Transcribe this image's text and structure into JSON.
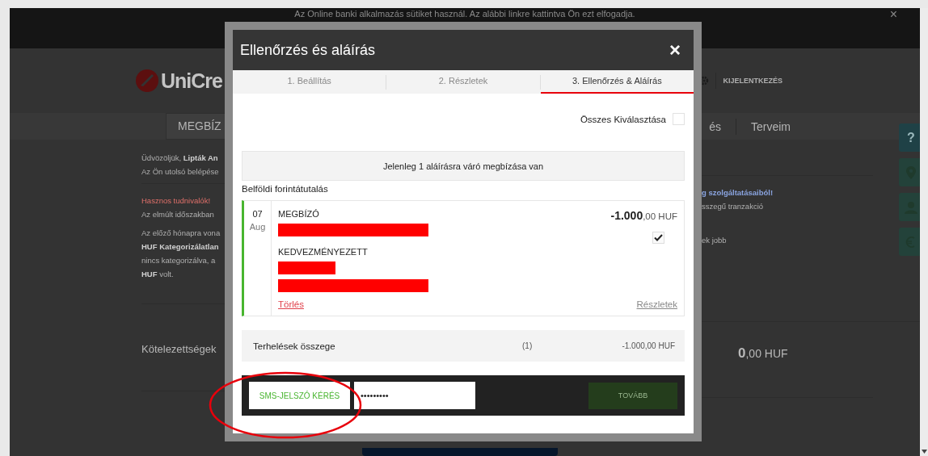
{
  "cookie_bar": {
    "text": "Az Online banki alkalmazás sütiket használ. Az alábbi linkre kattintva Ön ezt elfogadja.",
    "close": "×"
  },
  "header": {
    "logo": "UniCre",
    "logout": "KIJELENTKEZÉS"
  },
  "nav": [
    {
      "label": "MEGBÍZ",
      "selected": true
    },
    {
      "label": "és",
      "selected": false
    },
    {
      "label": "Terveim",
      "selected": false
    }
  ],
  "left_column": {
    "greeting": "Üdvözöljük, **Lipták An**",
    "last_login": "Az Ön utolsó belépése",
    "notice_title": "Hasznos tudnivalók!",
    "notice_text": "Az elmúlt időszakban",
    "summary": [
      "Az előző hónapra vona",
      "**HUF Kategorizálatlan**",
      "nincs kategorizálva, a",
      "**HUF** volt."
    ],
    "liabilities": "Kötelezettségek"
  },
  "help_button": "?",
  "right_column": {
    "notice_link": "g szolgáltatásaiból!",
    "notice_text": "sszegű tranzakció",
    "summary": "ek jobb",
    "liabilities_amount": "0",
    "liabilities_decimals": ",00 HUF"
  },
  "modal": {
    "title": "Ellenőrzés és aláírás",
    "close": "×",
    "steps": [
      {
        "label": "1. Beállítás",
        "selected": false
      },
      {
        "label": "2. Részletek",
        "selected": false
      },
      {
        "label": "3. Ellenőrzés & Aláírás",
        "selected": true
      }
    ],
    "select_all": {
      "label": "Összes Kiválasztása",
      "checked": false
    },
    "pending_notice": "Jelenleg 1 aláírásra váró megbízása van",
    "group_title": "Belföldi forintátutalás",
    "orders": [
      {
        "day": "07",
        "month": "Aug",
        "payer_label": "MEGBÍZÓ",
        "payee_label": "KEDVEZMÉNYEZETT",
        "amount": "-1.000",
        "decimals": ",00 HUF",
        "checked": true,
        "delete": "Törlés",
        "details": "Részletek"
      }
    ],
    "total": {
      "label": "Terhelések összege",
      "count": "(1)",
      "amount": "-1.000,00 HUF"
    },
    "sms_button": "SMS-JELSZÓ KÉRÉS",
    "password": {
      "value": "•••••••••"
    },
    "next": {
      "label": "TOVÁBB",
      "disabled": true
    }
  }
}
